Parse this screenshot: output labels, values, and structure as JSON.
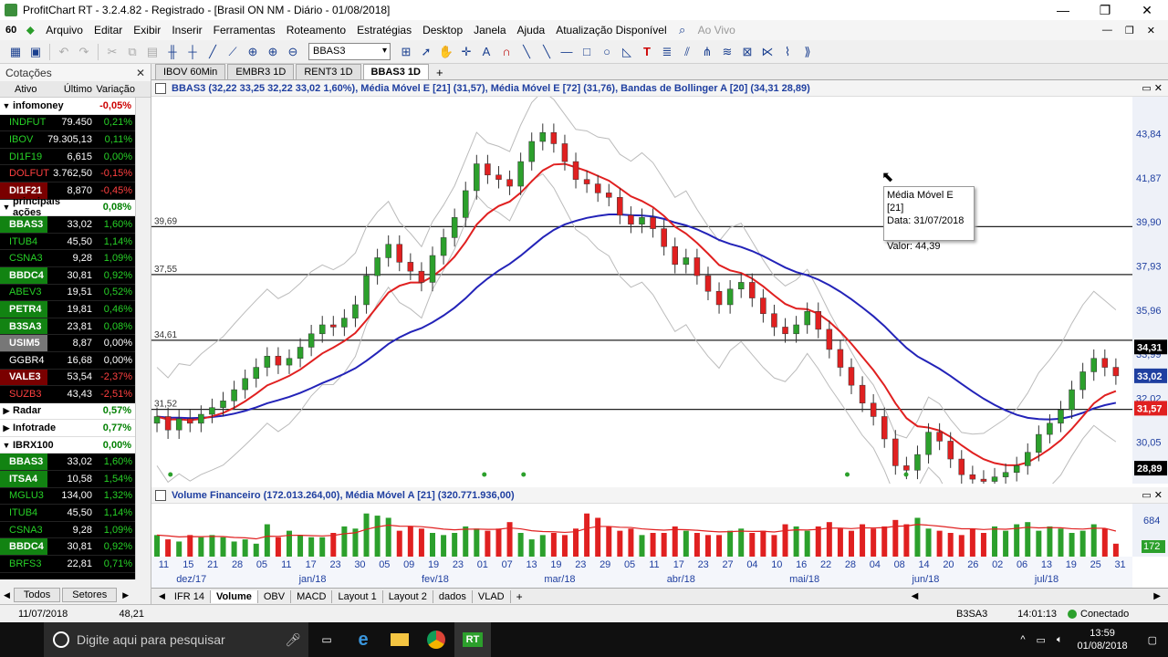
{
  "window": {
    "title": "ProfitChart RT - 3.2.4.82 - Registrado - [Brasil ON NM - Diário - 01/08/2018]"
  },
  "menu": [
    "Arquivo",
    "Editar",
    "Exibir",
    "Inserir",
    "Ferramentas",
    "Roteamento",
    "Estratégias",
    "Desktop",
    "Janela",
    "Ajuda",
    "Atualização Disponível"
  ],
  "menu_live": "Ao Vivo",
  "toolbar": {
    "symbol_select": "BBAS3"
  },
  "cotacoes": {
    "title": "Cotações",
    "columns": [
      "Ativo",
      "Último",
      "Variação"
    ],
    "groups": [
      {
        "name": "infomoney",
        "var": "-0,05%",
        "color": "#cc0000",
        "rows": [
          {
            "sym": "INDFUT",
            "last": "79.450",
            "var": "0,21%",
            "bg": "#000",
            "fg": "#27d127"
          },
          {
            "sym": "IBOV",
            "last": "79.305,13",
            "var": "0,11%",
            "bg": "#000",
            "fg": "#27d127"
          },
          {
            "sym": "DI1F19",
            "last": "6,615",
            "var": "0,00%",
            "bg": "#000",
            "fg": "#27d127"
          },
          {
            "sym": "DOLFUT",
            "last": "3.762,50",
            "var": "-0,15%",
            "bg": "#000",
            "fg": "#ff4040"
          },
          {
            "sym": "DI1F21",
            "last": "8,870",
            "var": "-0,45%",
            "bg": "#7a0000",
            "fg": "#ff4040"
          }
        ]
      },
      {
        "name": "principais ações",
        "var": "0,08%",
        "color": "#008000",
        "rows": [
          {
            "sym": "BBAS3",
            "last": "33,02",
            "var": "1,60%",
            "bg": "#128312",
            "fg": "#27d127"
          },
          {
            "sym": "ITUB4",
            "last": "45,50",
            "var": "1,14%",
            "bg": "#000",
            "fg": "#27d127"
          },
          {
            "sym": "CSNA3",
            "last": "9,28",
            "var": "1,09%",
            "bg": "#000",
            "fg": "#27d127"
          },
          {
            "sym": "BBDC4",
            "last": "30,81",
            "var": "0,92%",
            "bg": "#128312",
            "fg": "#27d127"
          },
          {
            "sym": "ABEV3",
            "last": "19,51",
            "var": "0,52%",
            "bg": "#000",
            "fg": "#27d127"
          },
          {
            "sym": "PETR4",
            "last": "19,81",
            "var": "0,46%",
            "bg": "#128312",
            "fg": "#27d127"
          },
          {
            "sym": "B3SA3",
            "last": "23,81",
            "var": "0,08%",
            "bg": "#128312",
            "fg": "#27d127"
          },
          {
            "sym": "USIM5",
            "last": "8,87",
            "var": "0,00%",
            "bg": "#777",
            "fg": "#fff"
          },
          {
            "sym": "GGBR4",
            "last": "16,68",
            "var": "0,00%",
            "bg": "#000",
            "fg": "#fff"
          },
          {
            "sym": "VALE3",
            "last": "53,54",
            "var": "-2,37%",
            "bg": "#7a0000",
            "fg": "#ff4040"
          },
          {
            "sym": "SUZB3",
            "last": "43,43",
            "var": "-2,51%",
            "bg": "#000",
            "fg": "#ff4040"
          }
        ]
      },
      {
        "name": "Radar",
        "var": "0,57%",
        "color": "#008000",
        "rows": []
      },
      {
        "name": "Infotrade",
        "var": "0,77%",
        "color": "#008000",
        "rows": []
      },
      {
        "name": "IBRX100",
        "var": "0,00%",
        "color": "#008000",
        "rows": [
          {
            "sym": "BBAS3",
            "last": "33,02",
            "var": "1,60%",
            "bg": "#128312",
            "fg": "#27d127"
          },
          {
            "sym": "ITSA4",
            "last": "10,58",
            "var": "1,54%",
            "bg": "#128312",
            "fg": "#27d127"
          },
          {
            "sym": "MGLU3",
            "last": "134,00",
            "var": "1,32%",
            "bg": "#000",
            "fg": "#27d127"
          },
          {
            "sym": "ITUB4",
            "last": "45,50",
            "var": "1,14%",
            "bg": "#000",
            "fg": "#27d127"
          },
          {
            "sym": "CSNA3",
            "last": "9,28",
            "var": "1,09%",
            "bg": "#000",
            "fg": "#27d127"
          },
          {
            "sym": "BBDC4",
            "last": "30,81",
            "var": "0,92%",
            "bg": "#128312",
            "fg": "#27d127"
          },
          {
            "sym": "BRFS3",
            "last": "22,81",
            "var": "0,71%",
            "bg": "#000",
            "fg": "#27d127"
          }
        ]
      }
    ],
    "tabs": [
      "Todos",
      "Setores"
    ]
  },
  "chart_tabs": [
    "IBOV 60Min",
    "EMBR3 1D",
    "RENT3 1D",
    "BBAS3 1D"
  ],
  "chart_tab_active": "BBAS3 1D",
  "price_header": "BBAS3 (32,22  33,25  32,22  33,02  1,60%), Média Móvel E [21] (31,57), Média Móvel E [72] (31,76), Bandas de Bollinger A [20] (34,31  28,89)",
  "volume_header": "Volume Financeiro (172.013.264,00), Média Móvel A [21] (320.771.936,00)",
  "tooltip": {
    "line1": "Média Móvel E [21]",
    "line2": "Data: 31/07/2018",
    "line3": "Valor: 44,39"
  },
  "chart_data": {
    "type": "candlestick",
    "symbol": "BBAS3",
    "price_axis_ticks": [
      "43,84",
      "41,87",
      "39,90",
      "37,93",
      "35,96",
      "33,99",
      "32,02",
      "30,05",
      "28,89"
    ],
    "price_axis_range": [
      28.2,
      45.5
    ],
    "horizontal_lines": [
      {
        "label": "39,69",
        "value": 39.69
      },
      {
        "label": "37,55",
        "value": 37.55
      },
      {
        "label": "34,61",
        "value": 34.61
      },
      {
        "label": "31,52",
        "value": 31.52
      }
    ],
    "last_markers": [
      {
        "label": "34,31",
        "value": 34.31,
        "color": "#000000"
      },
      {
        "label": "33,02",
        "value": 33.02,
        "color": "#1f3fa0"
      },
      {
        "label": "31,57",
        "value": 31.57,
        "color": "#e02020"
      },
      {
        "label": "28,89",
        "value": 28.89,
        "color": "#000000"
      }
    ],
    "x_day_labels": [
      "11",
      "15",
      "21",
      "28",
      "05",
      "11",
      "17",
      "23",
      "30",
      "05",
      "09",
      "19",
      "23",
      "01",
      "07",
      "13",
      "19",
      "23",
      "29",
      "05",
      "11",
      "17",
      "23",
      "27",
      "04",
      "10",
      "16",
      "22",
      "28",
      "04",
      "08",
      "14",
      "20",
      "26",
      "02",
      "06",
      "13",
      "19",
      "25",
      "31"
    ],
    "x_month_labels": [
      "dez/17",
      "jan/18",
      "fev/18",
      "mar/18",
      "abr/18",
      "mai/18",
      "jun/18",
      "jul/18"
    ],
    "close_path": [
      31.2,
      30.6,
      31.1,
      30.9,
      31.3,
      31.6,
      31.9,
      32.4,
      32.9,
      33.4,
      33.9,
      33.5,
      33.8,
      34.3,
      34.9,
      35.3,
      35.2,
      35.6,
      36.2,
      37.5,
      38.3,
      38.9,
      38.1,
      37.7,
      37.2,
      38.4,
      39.2,
      40.1,
      41.3,
      42.5,
      42.0,
      41.8,
      41.5,
      42.6,
      43.5,
      43.9,
      43.4,
      42.6,
      41.8,
      41.6,
      41.2,
      41.0,
      40.2,
      39.8,
      40.1,
      39.6,
      38.8,
      38.0,
      38.3,
      37.5,
      36.8,
      36.2,
      36.9,
      37.2,
      36.5,
      35.8,
      35.2,
      34.9,
      35.3,
      35.9,
      35.1,
      34.2,
      33.4,
      32.6,
      31.8,
      31.2,
      30.2,
      29.0,
      28.8,
      29.5,
      30.5,
      30.1,
      29.3,
      28.6,
      28.4,
      28.3,
      28.5,
      28.7,
      29.0,
      29.6,
      30.4,
      30.9,
      31.5,
      32.4,
      33.2,
      33.8,
      33.4,
      33.02
    ],
    "ema21_range": [
      31.57,
      42.3
    ],
    "ema72_range": [
      31.76,
      38.4
    ],
    "volume_axis_ticks": [
      "684",
      "172"
    ],
    "volume_values": [
      1.0,
      0.8,
      0.7,
      1.0,
      0.9,
      1.0,
      0.9,
      0.7,
      0.8,
      0.6,
      1.5,
      0.9,
      1.2,
      1.0,
      0.9,
      0.9,
      1.1,
      1.4,
      1.3,
      2.0,
      1.9,
      1.8,
      1.2,
      1.4,
      1.3,
      1.1,
      1.0,
      1.1,
      1.4,
      1.3,
      1.2,
      1.3,
      1.6,
      1.1,
      0.8,
      1.0,
      1.1,
      1.0,
      1.3,
      2.0,
      1.8,
      1.4,
      1.2,
      1.3,
      1.0,
      1.1,
      1.1,
      1.4,
      1.2,
      1.1,
      1.0,
      1.0,
      1.2,
      1.3,
      1.1,
      1.2,
      1.0,
      1.5,
      1.4,
      1.2,
      1.4,
      1.6,
      1.3,
      1.2,
      1.5,
      1.3,
      1.4,
      1.7,
      1.5,
      1.8,
      1.3,
      1.2,
      1.1,
      1.0,
      1.3,
      1.1,
      1.4,
      1.2,
      1.5,
      1.6,
      1.2,
      1.4,
      1.3,
      1.1,
      1.2,
      1.5,
      1.3,
      0.6
    ]
  },
  "bottom_tabs": [
    "IFR 14",
    "Volume",
    "OBV",
    "MACD",
    "Layout 1",
    "Layout 2",
    "dados",
    "VLAD"
  ],
  "bottom_tab_active": "Volume",
  "status": {
    "date": "11/07/2018",
    "value": "48,21",
    "symbol": "B3SA3",
    "time": "14:01:13",
    "connection": "Conectado"
  },
  "taskbar": {
    "search_placeholder": "Digite aqui para pesquisar",
    "app_label": "RT",
    "time": "13:59",
    "date": "01/08/2018"
  }
}
